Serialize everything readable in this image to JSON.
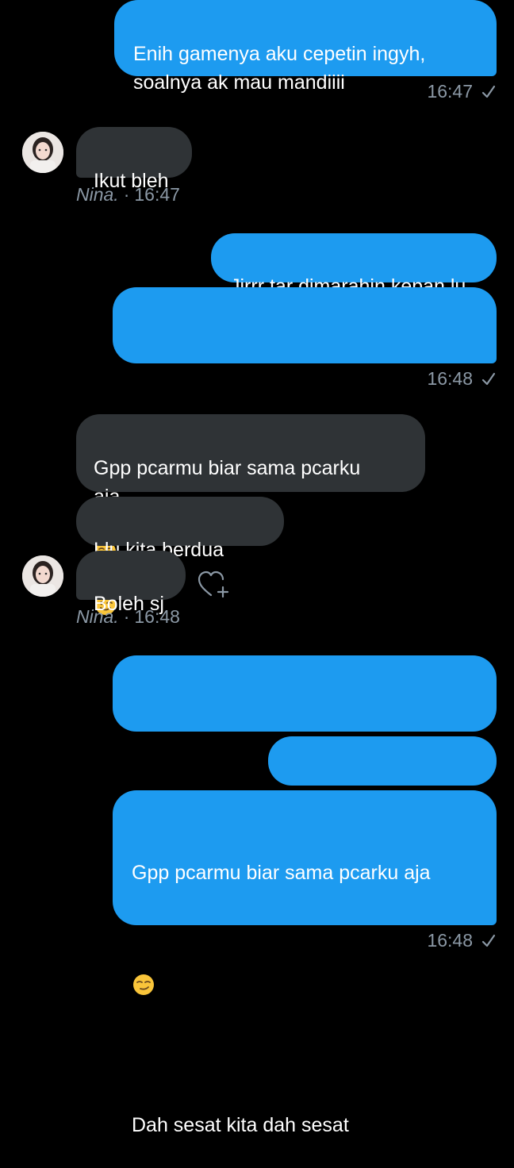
{
  "messages": {
    "m1": {
      "text": "Enih gamenya aku cepetin ingyh,\nsoalnya ak mau mandiiii",
      "time": "16:47"
    },
    "m2": {
      "text": "Ikut bleh",
      "sender": "Nina.",
      "time": "16:47"
    },
    "m3": {
      "text": "Jirrr tar dimarahin kepan lu",
      "time": "16:48"
    },
    "m4": {
      "text": "Gpp pcarmu biar sama pcarku\naja"
    },
    "m5": {
      "text": "Llu kita berdua"
    },
    "m6": {
      "text": "Boleh sj",
      "sender": "Nina.",
      "time": "16:48"
    },
    "m7": {
      "line1": "Gpp pcarmu biar sama pcarku aja",
      "line2": "Dah sesat kita dah sesat",
      "time": "16:48"
    }
  },
  "icons": {
    "check": "check-icon",
    "heart_add": "heart-plus-icon",
    "smirk_emoji": "smirking-face-emoji",
    "wink_emoji": "winking-face-emoji"
  },
  "colors": {
    "background": "#000000",
    "outgoing_bubble": "#1d9bf0",
    "incoming_bubble": "#2f3336",
    "meta_text": "#8b98a5"
  }
}
